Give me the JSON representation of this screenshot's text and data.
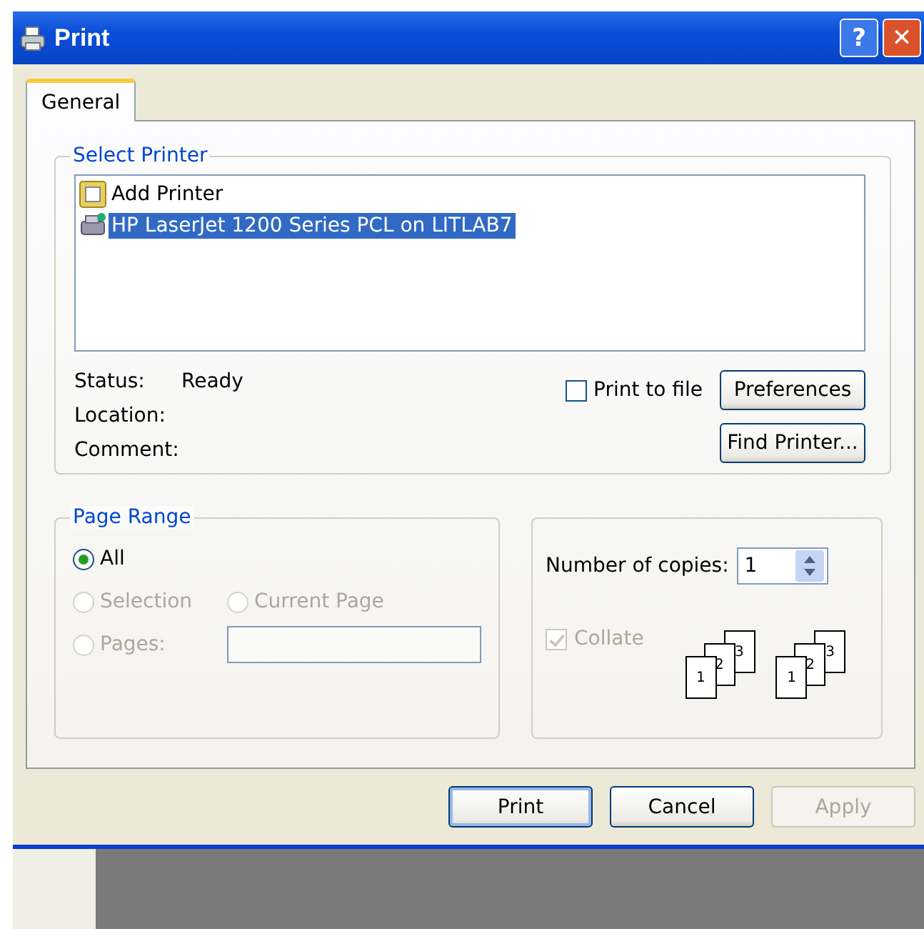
{
  "window": {
    "title": "Print"
  },
  "title_buttons": [
    {
      "kind": "help",
      "label": "?"
    },
    {
      "kind": "close",
      "label": "✕"
    }
  ],
  "tabs": [
    {
      "label": "General",
      "selected": true
    }
  ],
  "select_printer": {
    "legend": "Select Printer",
    "printers": [
      {
        "kind": "add",
        "name": "Add Printer",
        "selected": false
      },
      {
        "kind": "printer",
        "name": "HP LaserJet 1200 Series PCL on LITLAB7",
        "selected": true
      }
    ],
    "info": [
      {
        "label": "Status:",
        "value": "Ready"
      },
      {
        "label": "Location:"
      },
      {
        "label": "Comment:"
      }
    ],
    "print_to_file": {
      "label": "Print to file",
      "checked": false
    },
    "buttons": [
      "Preferences",
      "Find Printer..."
    ]
  },
  "page_range": {
    "legend": "Page Range",
    "options": [
      {
        "label": "All",
        "selected": true,
        "disabled": false
      },
      {
        "label": "Selection",
        "selected": false,
        "disabled": true
      },
      {
        "label": "Current Page",
        "selected": false,
        "disabled": true
      },
      {
        "label": "Pages:",
        "selected": false,
        "disabled": true
      }
    ]
  },
  "copies": {
    "label": "Number of copies:",
    "value": "1",
    "collate": {
      "label": "Collate",
      "checked": true,
      "disabled": true
    },
    "illustrations": [
      {
        "pages": [
          "1",
          "2",
          "3"
        ]
      },
      {
        "pages": [
          "1",
          "2",
          "3"
        ]
      }
    ]
  },
  "buttons": [
    {
      "label": "Print",
      "disabled": false
    },
    {
      "label": "Cancel",
      "disabled": false
    },
    {
      "label": "Apply",
      "disabled": true
    }
  ]
}
